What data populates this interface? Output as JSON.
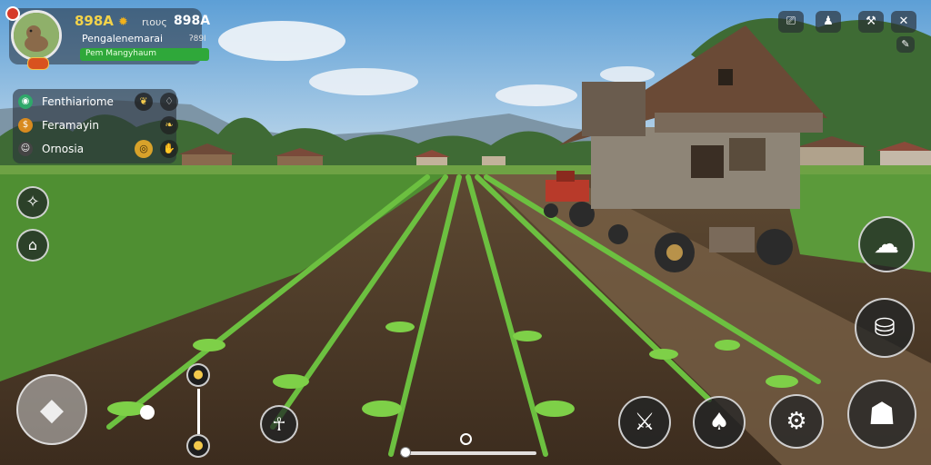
{
  "player": {
    "currency": "898A",
    "coin_icon": "coin-icon",
    "res_label": "rιους",
    "res_value": "898A",
    "name": "Pengalenemarai",
    "number": "ʔ89Ι",
    "status": "Pem Mangyhaum"
  },
  "quests": [
    {
      "label": "Fenthiariome",
      "icon": "wheat-icon",
      "color": "#2fa86a",
      "right_icon": "sprout-icon"
    },
    {
      "label": "Feramayin",
      "icon": "seed-icon",
      "color": "#d88a1f",
      "right_icon": "leaf-icon"
    },
    {
      "label": "Ornosia",
      "icon": "face-icon",
      "color": "#444444",
      "right_icon": "hand-icon"
    }
  ],
  "top_buttons": [
    "camera-icon",
    "profile-icon",
    "tools-icon",
    "close-icon"
  ],
  "left_actions": [
    "compass-icon",
    "hoe-icon"
  ],
  "joystick": "move-joystick-icon",
  "center_actions": [
    "water-drop-icon",
    "scarecrow-icon"
  ],
  "right_actions": [
    "plant-icon",
    "harvest-icon"
  ],
  "bottom_actions": [
    "sickle-icon",
    "shovel-icon",
    "settings-icon",
    "rock-icon"
  ],
  "colors": {
    "accent": "#2fa83a",
    "gold": "#f3d34a",
    "panel": "#28303a"
  }
}
